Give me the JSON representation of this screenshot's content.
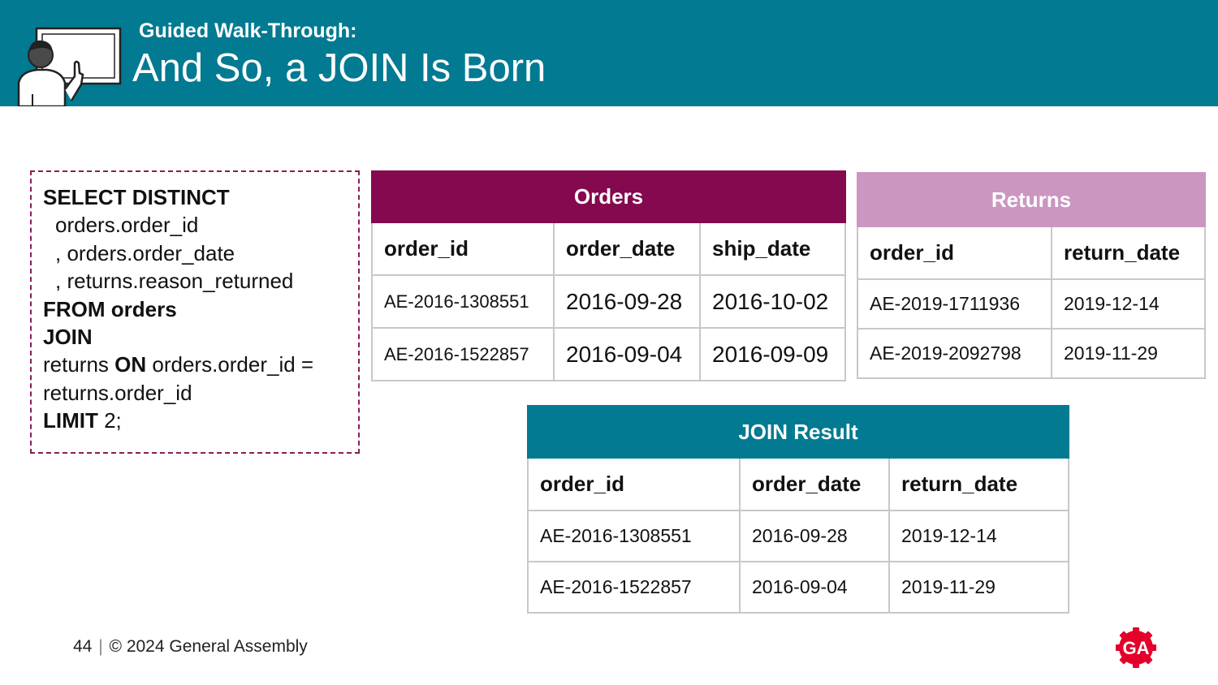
{
  "header": {
    "kicker": "Guided Walk-Through:",
    "title": "And So, a JOIN Is Born"
  },
  "query": {
    "l1": "SELECT DISTINCT",
    "l2": "orders.order_id",
    "l3": ", orders.order_date",
    "l4": ", returns.reason_returned",
    "l5": "FROM orders",
    "l6": "JOIN",
    "l7a": "returns ",
    "l7b": "ON",
    "l7c": " orders.order_id =",
    "l8": "returns.order_id",
    "l9a": "LIMIT",
    "l9b": " 2;"
  },
  "orders_table": {
    "caption": "Orders",
    "headers": [
      "order_id",
      "order_date",
      "ship_date"
    ],
    "rows": [
      [
        "AE-2016-1308551",
        "2016-09-28",
        "2016-10-02"
      ],
      [
        "AE-2016-1522857",
        "2016-09-04",
        "2016-09-09"
      ]
    ]
  },
  "returns_table": {
    "caption": "Returns",
    "headers": [
      "order_id",
      "return_date"
    ],
    "rows": [
      [
        "AE-2019-1711936",
        "2019-12-14"
      ],
      [
        "AE-2019-2092798",
        "2019-11-29"
      ]
    ]
  },
  "join_table": {
    "caption": "JOIN Result",
    "headers": [
      "order_id",
      "order_date",
      "return_date"
    ],
    "rows": [
      [
        "AE-2016-1308551",
        "2016-09-28",
        "2019-12-14"
      ],
      [
        "AE-2016-1522857",
        "2016-09-04",
        "2019-11-29"
      ]
    ]
  },
  "footer": {
    "page": "44",
    "separator": "|",
    "copyright": "© 2024 General Assembly"
  },
  "logo": {
    "text": "GA",
    "color": "#e4002b"
  },
  "icons": {
    "presenter": "presenter-icon",
    "logo": "ga-logo-icon"
  },
  "colors": {
    "header": "#017a92",
    "orders": "#85094f",
    "returns": "#cb96c0",
    "join": "#017a92"
  }
}
